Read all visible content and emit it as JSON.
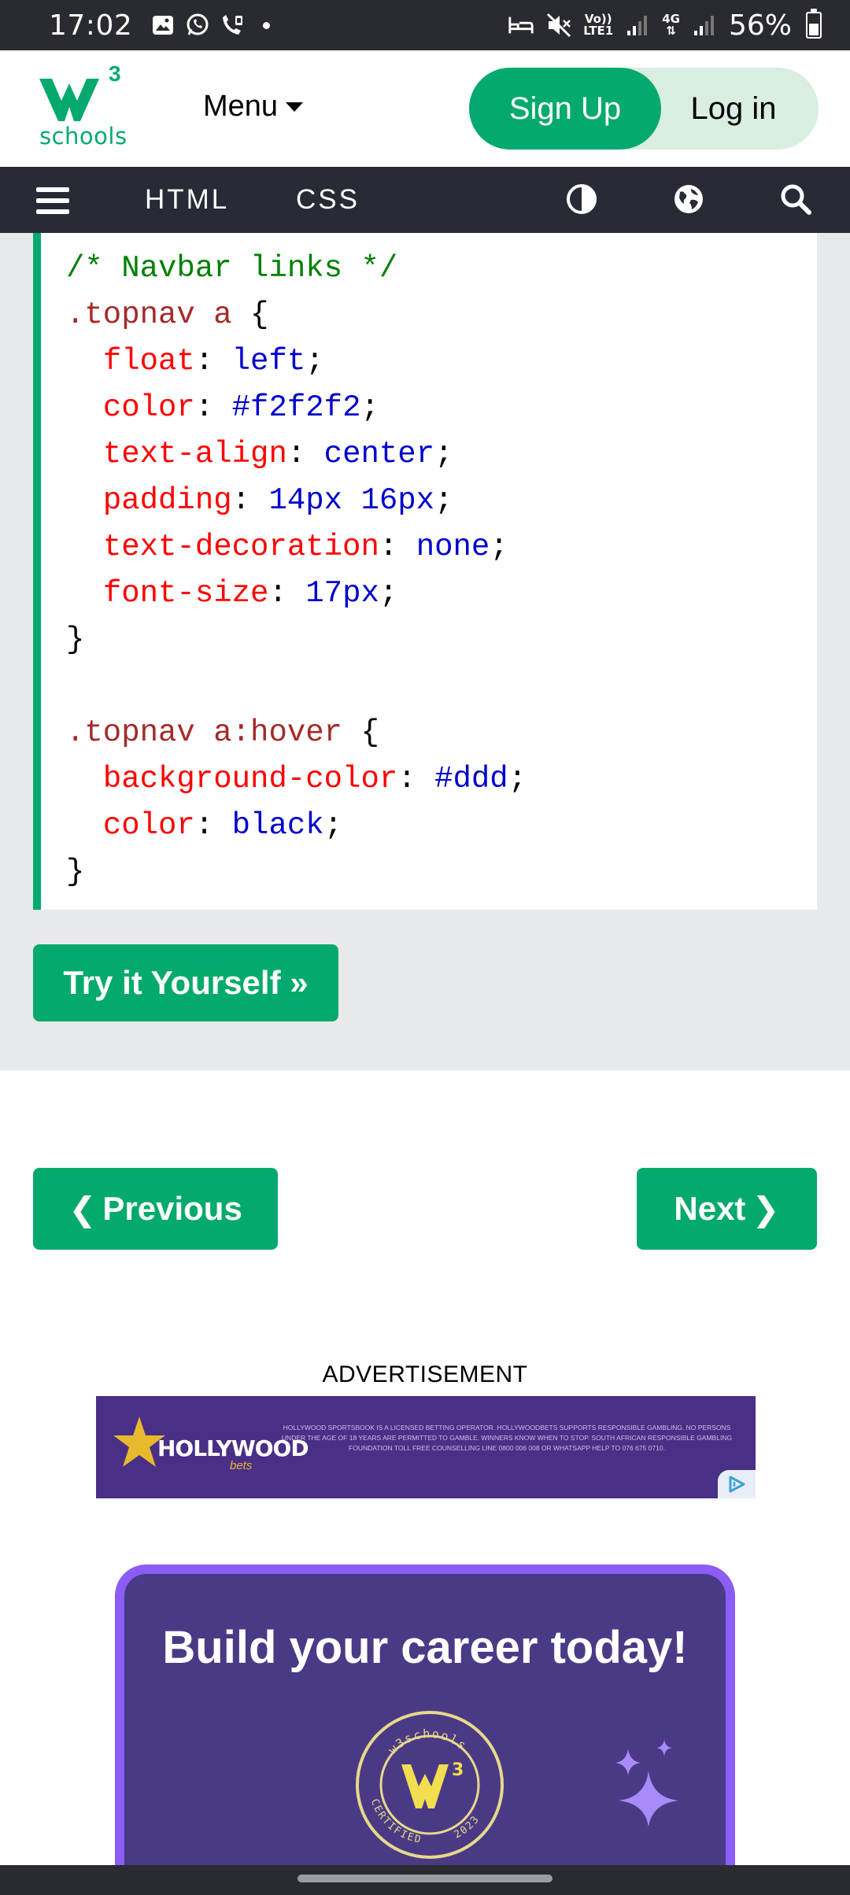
{
  "status_bar": {
    "time": "17:02",
    "network_top": "Vo))",
    "network_bottom": "LTE1",
    "data_type_top": "4G",
    "data_type_bottom": "⇅",
    "battery": "56%",
    "battery_level": 0.56
  },
  "header": {
    "logo_text": "schools",
    "logo_superscript": "3",
    "menu_label": "Menu",
    "signup_label": "Sign Up",
    "login_label": "Log in"
  },
  "topnav": {
    "links": [
      "HTML",
      "CSS"
    ]
  },
  "code_example": {
    "lines": [
      [
        {
          "t": "/* Navbar links */",
          "c": "comment"
        }
      ],
      [
        {
          "t": ".topnav a ",
          "c": "sel"
        },
        {
          "t": "{",
          "c": "punct"
        }
      ],
      [
        {
          "t": "  ",
          "c": "punct"
        },
        {
          "t": "float",
          "c": "prop"
        },
        {
          "t": ": ",
          "c": "punct"
        },
        {
          "t": "left",
          "c": "val"
        },
        {
          "t": ";",
          "c": "punct"
        }
      ],
      [
        {
          "t": "  ",
          "c": "punct"
        },
        {
          "t": "color",
          "c": "prop"
        },
        {
          "t": ": ",
          "c": "punct"
        },
        {
          "t": "#f2f2f2",
          "c": "val"
        },
        {
          "t": ";",
          "c": "punct"
        }
      ],
      [
        {
          "t": "  ",
          "c": "punct"
        },
        {
          "t": "text-align",
          "c": "prop"
        },
        {
          "t": ": ",
          "c": "punct"
        },
        {
          "t": "center",
          "c": "val"
        },
        {
          "t": ";",
          "c": "punct"
        }
      ],
      [
        {
          "t": "  ",
          "c": "punct"
        },
        {
          "t": "padding",
          "c": "prop"
        },
        {
          "t": ": ",
          "c": "punct"
        },
        {
          "t": "14px 16px",
          "c": "val"
        },
        {
          "t": ";",
          "c": "punct"
        }
      ],
      [
        {
          "t": "  ",
          "c": "punct"
        },
        {
          "t": "text-decoration",
          "c": "prop"
        },
        {
          "t": ": ",
          "c": "punct"
        },
        {
          "t": "none",
          "c": "val"
        },
        {
          "t": ";",
          "c": "punct"
        }
      ],
      [
        {
          "t": "  ",
          "c": "punct"
        },
        {
          "t": "font-size",
          "c": "prop"
        },
        {
          "t": ": ",
          "c": "punct"
        },
        {
          "t": "17px",
          "c": "val"
        },
        {
          "t": ";",
          "c": "punct"
        }
      ],
      [
        {
          "t": "}",
          "c": "punct"
        }
      ],
      [
        {
          "t": "",
          "c": "punct"
        }
      ],
      [
        {
          "t": ".topnav a:hover ",
          "c": "sel"
        },
        {
          "t": "{",
          "c": "punct"
        }
      ],
      [
        {
          "t": "  ",
          "c": "punct"
        },
        {
          "t": "background-color",
          "c": "prop"
        },
        {
          "t": ": ",
          "c": "punct"
        },
        {
          "t": "#ddd",
          "c": "val"
        },
        {
          "t": ";",
          "c": "punct"
        }
      ],
      [
        {
          "t": "  ",
          "c": "punct"
        },
        {
          "t": "color",
          "c": "prop"
        },
        {
          "t": ": ",
          "c": "punct"
        },
        {
          "t": "black",
          "c": "val"
        },
        {
          "t": ";",
          "c": "punct"
        }
      ],
      [
        {
          "t": "}",
          "c": "punct"
        }
      ]
    ]
  },
  "try_it_label": "Try it Yourself »",
  "pagination": {
    "prev_label": "Previous",
    "prev_chevron": "❮",
    "next_label": "Next",
    "next_chevron": "❯"
  },
  "advertisement": {
    "label": "ADVERTISEMENT",
    "brand": "HOLLYWOOD",
    "brand_sub": "bets",
    "fine_print": "Hollywood Sportsbook is a licensed betting operator. Hollywoodbets supports responsible gambling. No persons under the age of 18 years are permitted to gamble. Winners know when to stop. South African Responsible Gambling Foundation toll free counselling line 0800 006 008 or WhatsApp help to 076 675 0710."
  },
  "promo": {
    "title": "Build your career today!",
    "badge_top": "w3schools",
    "badge_left": "CERTIFIED",
    "badge_right": "2023",
    "badge_logo_sup": "3"
  },
  "colors": {
    "brand_green": "#04aa6d",
    "nav_dark": "#282a35",
    "example_bg": "#e7e9eb",
    "promo_purple": "#4a3a86",
    "promo_border": "#8b5cf6"
  }
}
